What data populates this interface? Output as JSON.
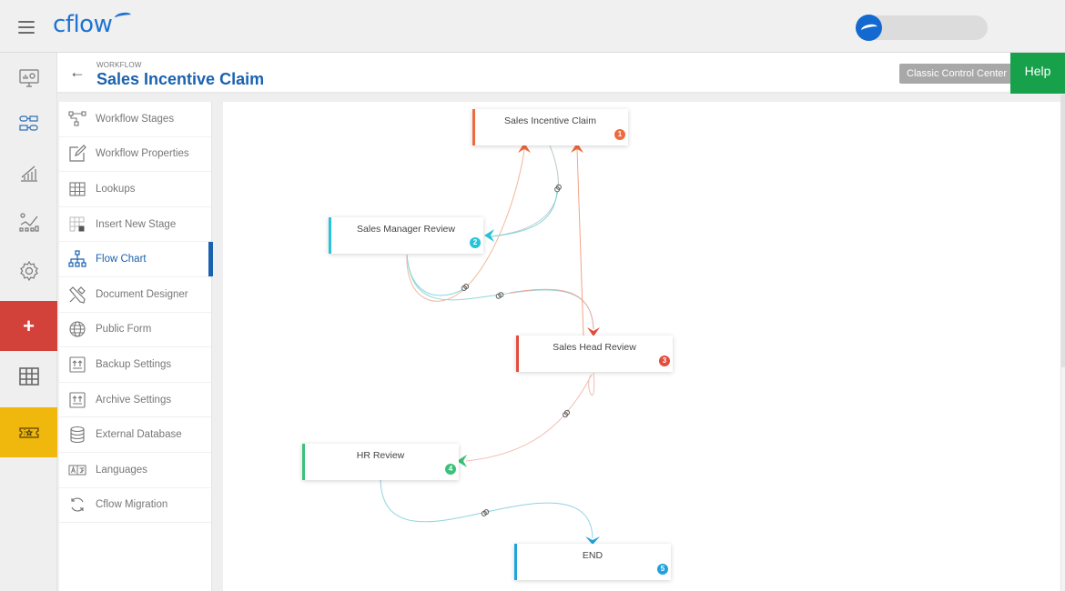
{
  "topbar": {
    "menu_icon": "hamburger-icon",
    "logo_text": "cflow",
    "user_avatar_icon": "cflow-avatar-icon"
  },
  "leftrail": {
    "items": [
      {
        "icon": "monitor-dashboard-icon"
      },
      {
        "icon": "workflow-config-icon"
      },
      {
        "icon": "reports-chart-icon"
      },
      {
        "icon": "analytics-icon"
      },
      {
        "icon": "settings-gear-icon"
      },
      {
        "icon": "plus-icon",
        "label": "+",
        "color": "#d2413a"
      },
      {
        "icon": "table-grid-icon"
      },
      {
        "icon": "ticket-star-icon",
        "color": "#f0b70d"
      }
    ]
  },
  "header": {
    "breadcrumb": "WORKFLOW",
    "title": "Sales Incentive Claim",
    "classic_button": "Classic Control Center",
    "help_button": "Help"
  },
  "submenu": {
    "active_index": 4,
    "items": [
      {
        "label": "Workflow Stages",
        "icon": "workflow-stages-icon"
      },
      {
        "label": "Workflow Properties",
        "icon": "edit-properties-icon"
      },
      {
        "label": "Lookups",
        "icon": "lookups-table-icon"
      },
      {
        "label": "Insert New Stage",
        "icon": "insert-stage-icon"
      },
      {
        "label": "Flow Chart",
        "icon": "flow-chart-icon"
      },
      {
        "label": "Document Designer",
        "icon": "document-designer-icon"
      },
      {
        "label": "Public Form",
        "icon": "globe-icon"
      },
      {
        "label": "Backup Settings",
        "icon": "backup-icon"
      },
      {
        "label": "Archive Settings",
        "icon": "archive-icon"
      },
      {
        "label": "External Database",
        "icon": "database-icon"
      },
      {
        "label": "Languages",
        "icon": "languages-icon"
      },
      {
        "label": "Cflow Migration",
        "icon": "migration-icon"
      }
    ]
  },
  "flowchart": {
    "nodes": [
      {
        "name": "Sales Incentive Claim",
        "number": "1",
        "color": "#ee6a3c"
      },
      {
        "name": "Sales Manager Review",
        "number": "2",
        "color": "#27c3d8"
      },
      {
        "name": "Sales Head Review",
        "number": "3",
        "color": "#e44c3c"
      },
      {
        "name": "HR Review",
        "number": "4",
        "color": "#3cc07a"
      },
      {
        "name": "END",
        "number": "5",
        "color": "#1fa3db"
      }
    ],
    "link_icon": "link-chain-icon"
  }
}
